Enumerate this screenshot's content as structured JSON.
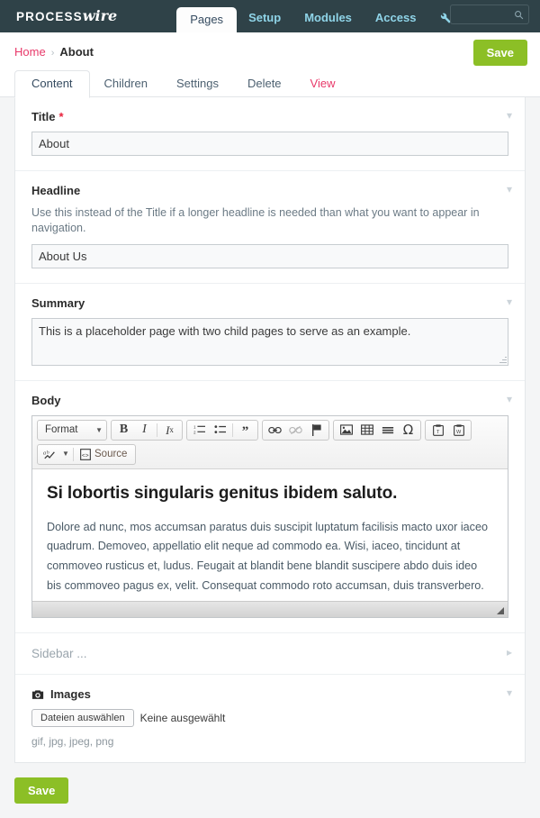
{
  "masthead": {
    "logo_process": "PROCESS",
    "logo_wire": "wire",
    "nav": [
      {
        "label": "Pages",
        "active": true
      },
      {
        "label": "Setup",
        "active": false
      },
      {
        "label": "Modules",
        "active": false
      },
      {
        "label": "Access",
        "active": false
      }
    ],
    "wrench_icon": "wrench-icon",
    "search_placeholder": "",
    "search_value": "",
    "search_icon": "search-icon",
    "bg_color": "#2f4248",
    "link_color": "#8fd4e8"
  },
  "breadcrumb": {
    "home": "Home",
    "separator": "›",
    "current": "About"
  },
  "toolbar": {
    "save_label": "Save",
    "save_color": "#8cbf26"
  },
  "page_tabs": [
    {
      "label": "Content",
      "active": true,
      "accent": false
    },
    {
      "label": "Children",
      "active": false,
      "accent": false
    },
    {
      "label": "Settings",
      "active": false,
      "accent": false
    },
    {
      "label": "Delete",
      "active": false,
      "accent": false
    },
    {
      "label": "View",
      "active": false,
      "accent": true
    }
  ],
  "accent_color": "#e8396a",
  "fields": {
    "title": {
      "label": "Title",
      "required_marker": "*",
      "value": "About",
      "toggle_icon": "chevron-down-icon"
    },
    "headline": {
      "label": "Headline",
      "note": "Use this instead of the Title if a longer headline is needed than what you want to appear in navigation.",
      "value": "About Us",
      "toggle_icon": "chevron-down-icon"
    },
    "summary": {
      "label": "Summary",
      "value": "This is a placeholder page with two child pages to serve as an example.",
      "toggle_icon": "chevron-down-icon"
    },
    "body": {
      "label": "Body",
      "toggle_icon": "chevron-down-icon",
      "editor": {
        "format_label": "Format",
        "source_label": "Source",
        "groups": [
          {
            "name": "format-group",
            "buttons": []
          },
          {
            "name": "text-style-group",
            "buttons": [
              "bold",
              "italic",
              "remove-format"
            ]
          },
          {
            "name": "list-group",
            "buttons": [
              "numbered-list",
              "bulleted-list",
              "blockquote"
            ]
          },
          {
            "name": "link-group",
            "buttons": [
              "link",
              "unlink",
              "anchor"
            ]
          },
          {
            "name": "insert-group",
            "buttons": [
              "image",
              "table",
              "horizontal-rule",
              "special-character"
            ]
          },
          {
            "name": "paste-group",
            "buttons": [
              "paste-as-text",
              "paste-from-word"
            ]
          },
          {
            "name": "tools-group",
            "buttons": [
              "spell-check",
              "source"
            ]
          }
        ],
        "heading": "Si lobortis singularis genitus ibidem saluto.",
        "paragraph": "Dolore ad nunc, mos accumsan paratus duis suscipit luptatum facilisis macto uxor iaceo quadrum. Demoveo, appellatio elit neque ad commodo ea. Wisi, iaceo, tincidunt at commoveo rusticus et, ludus. Feugait at blandit bene blandit suscipere abdo duis ideo bis commoveo pagus ex, velit. Consequat commodo roto accumsan, duis transverbero.",
        "resize_grip_icon": "resize-grip-icon"
      }
    },
    "sidebar": {
      "label": "Sidebar ...",
      "toggle_icon": "chevron-right-icon"
    },
    "images": {
      "label": "Images",
      "icon": "camera-icon",
      "choose_button": "Dateien auswählen",
      "no_file_text": "Keine ausgewählt",
      "allowed_extensions": "gif, jpg, jpeg, png",
      "toggle_icon": "chevron-down-icon"
    }
  },
  "footer": {
    "save_label": "Save"
  }
}
